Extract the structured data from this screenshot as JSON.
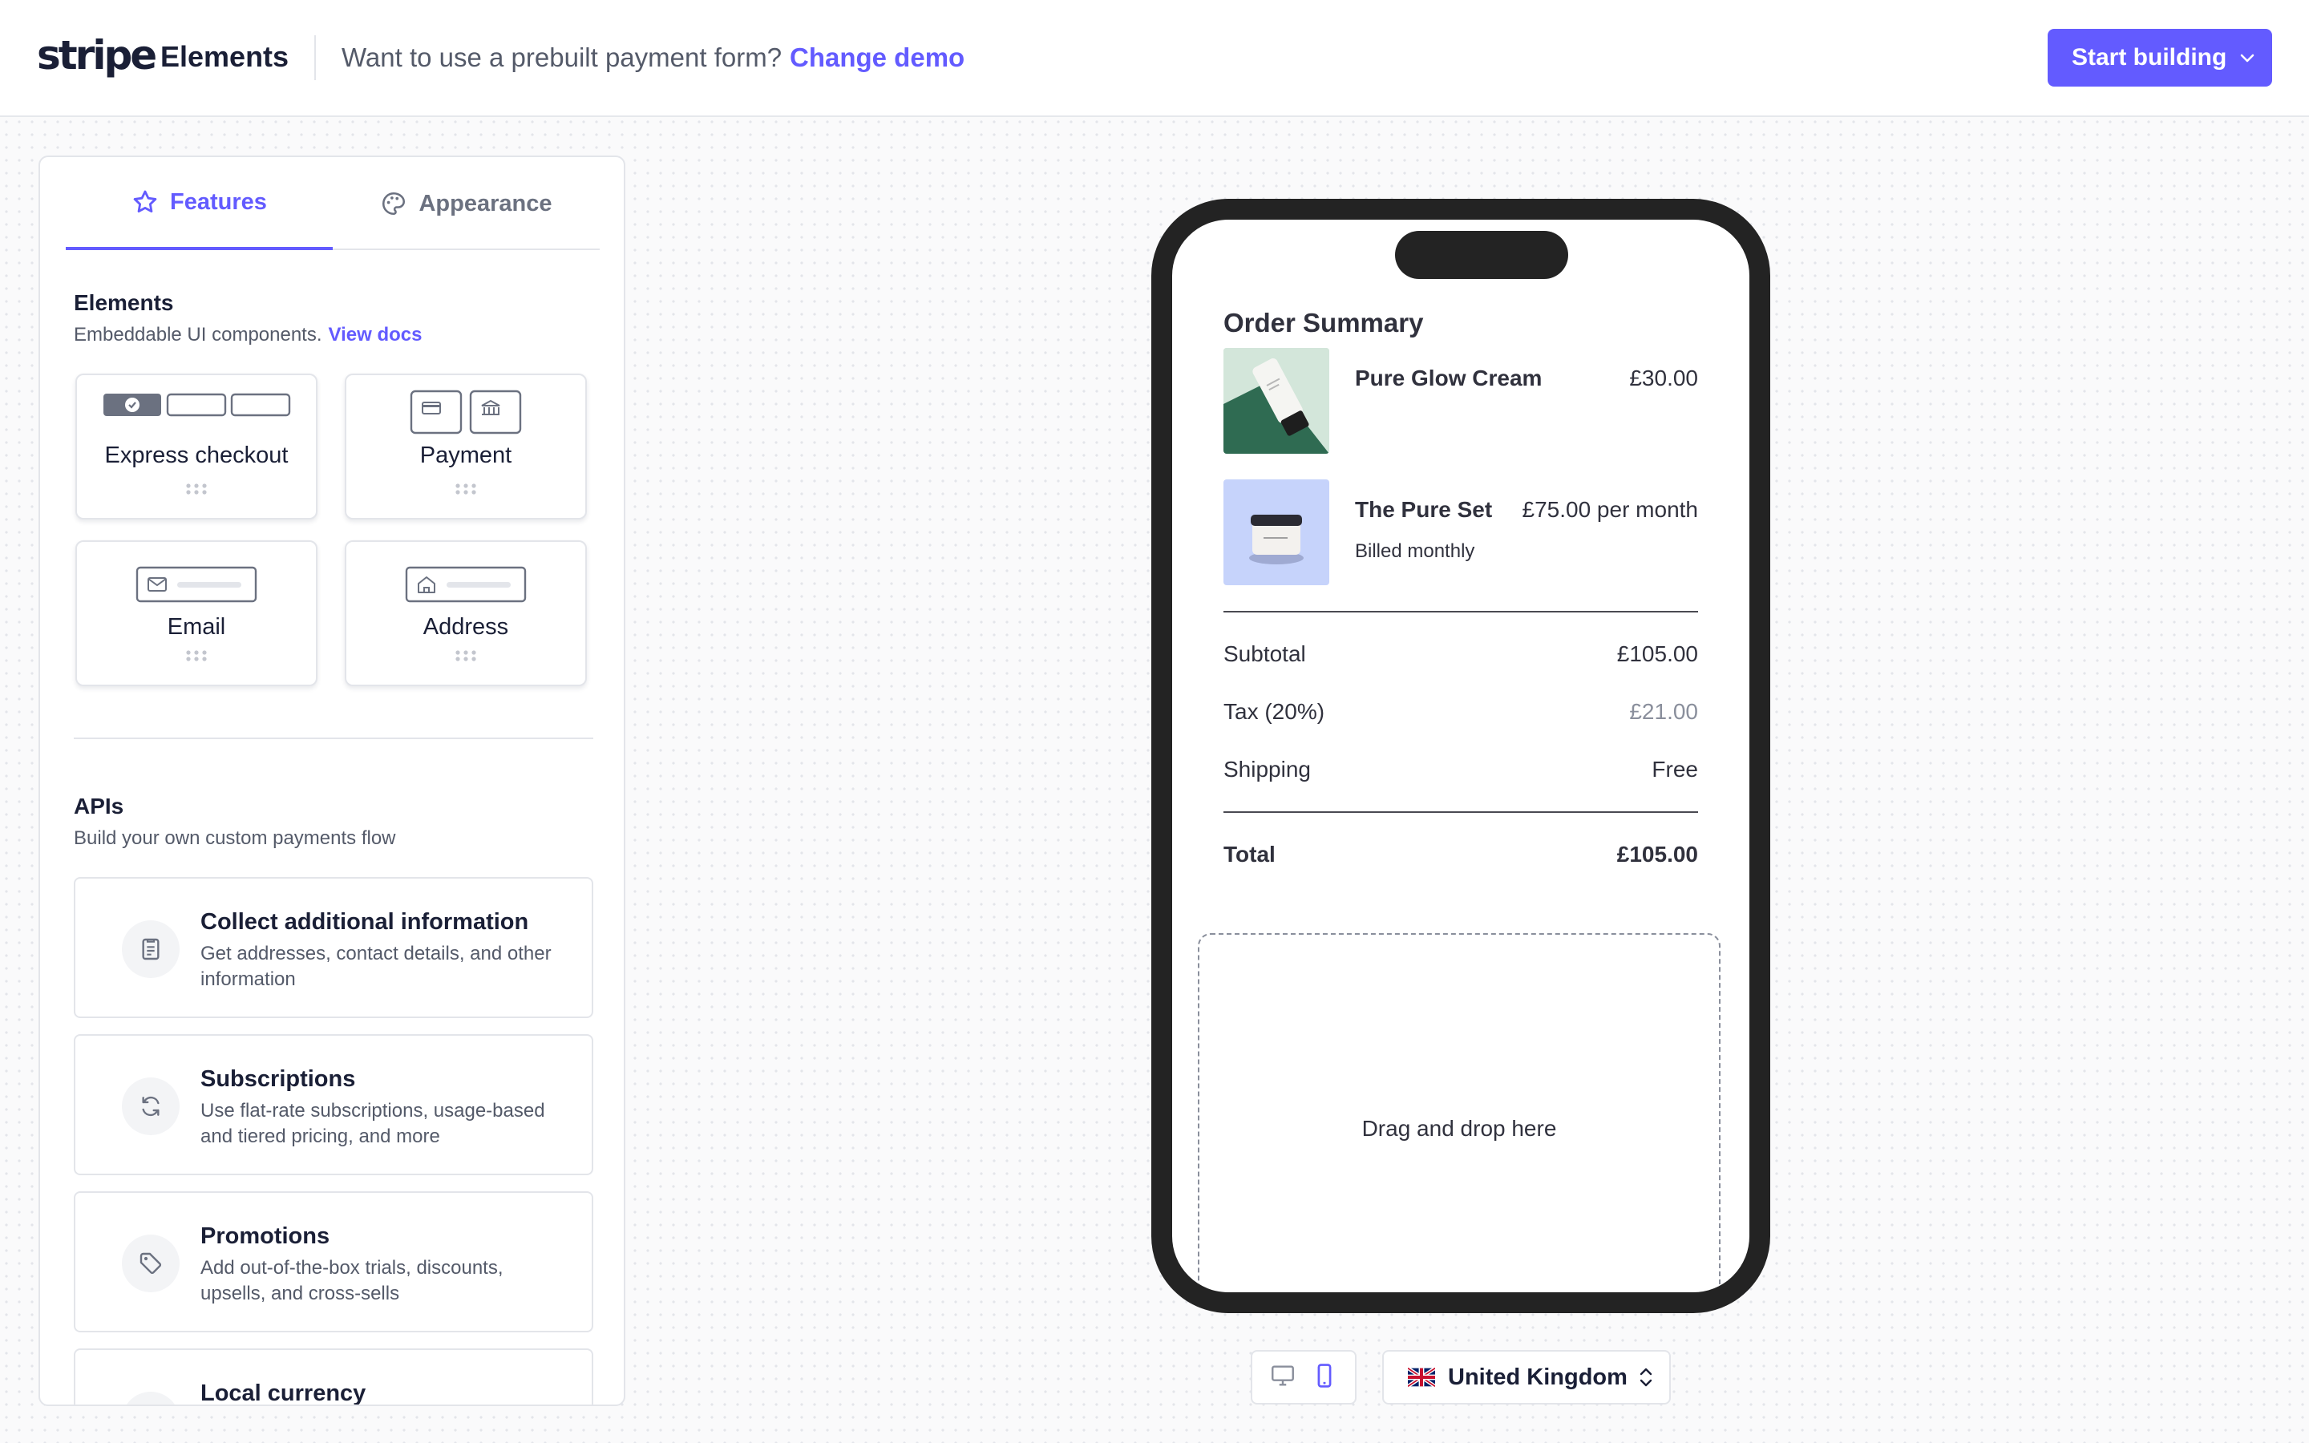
{
  "header": {
    "logo": "stripe",
    "title": "Elements",
    "question": "Want to use a prebuilt payment form?",
    "change_link": "Change demo",
    "start_button": "Start building"
  },
  "tabs": [
    {
      "label": "Features",
      "icon": "star-icon",
      "active": true
    },
    {
      "label": "Appearance",
      "icon": "palette-icon",
      "active": false
    }
  ],
  "elements_section": {
    "title": "Elements",
    "subtitle": "Embeddable UI components.",
    "docs_link": "View docs",
    "tiles": [
      {
        "label": "Express checkout"
      },
      {
        "label": "Payment"
      },
      {
        "label": "Email"
      },
      {
        "label": "Address"
      }
    ]
  },
  "apis_section": {
    "title": "APIs",
    "subtitle": "Build your own custom payments flow",
    "cards": [
      {
        "title": "Collect additional information",
        "desc": "Get addresses, contact details, and other information",
        "icon": "document-icon"
      },
      {
        "title": "Subscriptions",
        "desc": "Use flat-rate subscriptions, usage-based and tiered pricing, and more",
        "icon": "refresh-icon"
      },
      {
        "title": "Promotions",
        "desc": "Add out-of-the-box trials, discounts, upsells, and cross-sells",
        "icon": "tag-icon"
      },
      {
        "title": "Local currency",
        "desc": "",
        "icon": "currency-icon"
      }
    ]
  },
  "order_summary": {
    "title": "Order Summary",
    "items": [
      {
        "name": "Pure Glow Cream",
        "price": "£30.00",
        "sub": ""
      },
      {
        "name": "The Pure Set",
        "price": "£75.00 per month",
        "sub": "Billed monthly"
      }
    ],
    "subtotal_label": "Subtotal",
    "subtotal_value": "£105.00",
    "tax_label": "Tax (20%)",
    "tax_value": "£21.00",
    "shipping_label": "Shipping",
    "shipping_value": "Free",
    "total_label": "Total",
    "total_value": "£105.00",
    "dropzone_text": "Drag and drop here"
  },
  "footer_controls": {
    "country": "United Kingdom",
    "selected_device": "mobile"
  },
  "colors": {
    "accent": "#635bff",
    "text": "#1a1f36",
    "muted": "#545a69"
  }
}
